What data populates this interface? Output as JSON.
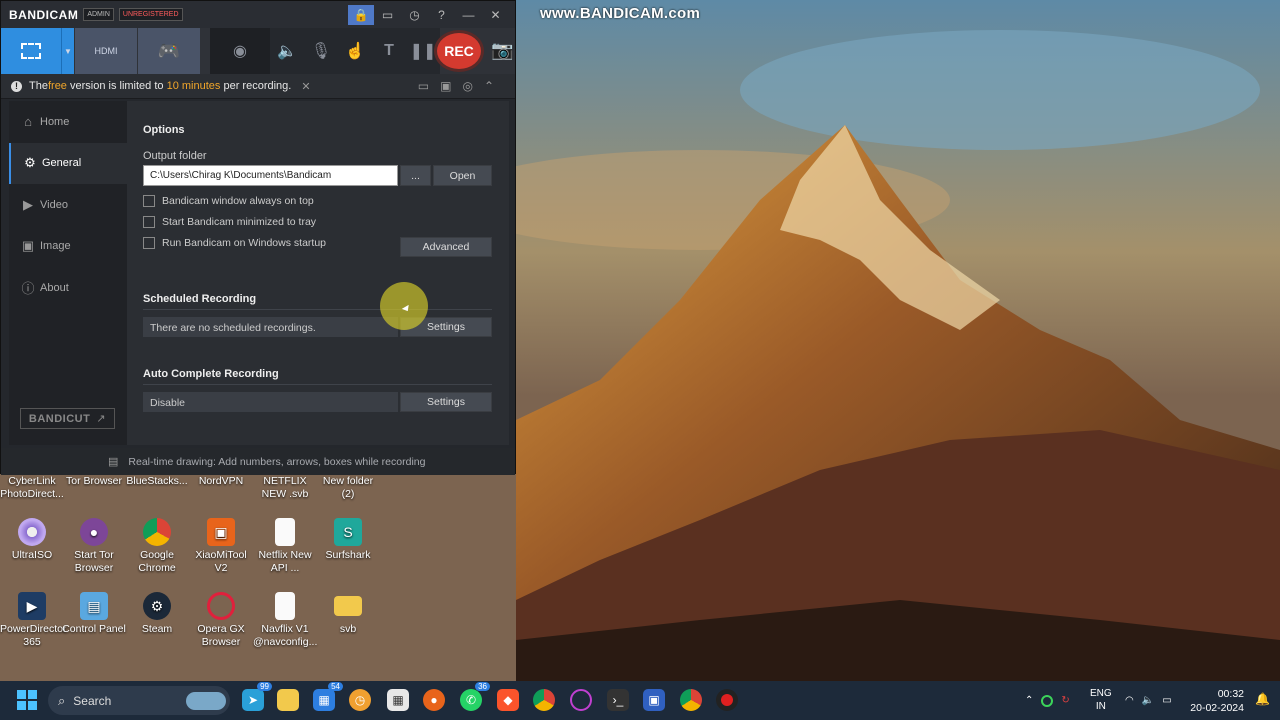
{
  "watermark": "www.BANDICAM.com",
  "window": {
    "app_name_prefix": "BANDI",
    "app_name_suffix": "CAM",
    "badge_admin": "ADMIN",
    "badge_unregistered": "UNREGISTERED",
    "rec_label": "REC",
    "notice": {
      "part1": "The ",
      "free": "free",
      "part2": " version is limited to ",
      "minutes": "10 minutes",
      "part3": " per recording."
    },
    "sidebar": {
      "items": [
        {
          "label": "Home",
          "icon": "home-icon"
        },
        {
          "label": "General",
          "icon": "gear-icon"
        },
        {
          "label": "Video",
          "icon": "video-icon"
        },
        {
          "label": "Image",
          "icon": "image-icon"
        },
        {
          "label": "About",
          "icon": "info-icon"
        }
      ],
      "bandicut": "BANDICUT"
    },
    "options": {
      "title": "Options",
      "output_folder_label": "Output folder",
      "output_folder_value": "C:\\Users\\Chirag K\\Documents\\Bandicam",
      "browse_label": "...",
      "open_label": "Open",
      "checkboxes": [
        "Bandicam window always on top",
        "Start Bandicam minimized to tray",
        "Run Bandicam on Windows startup"
      ],
      "advanced_label": "Advanced"
    },
    "scheduled": {
      "title": "Scheduled Recording",
      "value": "There are no scheduled recordings.",
      "settings_label": "Settings"
    },
    "autocomplete": {
      "title": "Auto Complete Recording",
      "value": "Disable",
      "settings_label": "Settings"
    },
    "footer": "Real-time drawing: Add numbers, arrows, boxes while recording"
  },
  "desktop": {
    "top_row": [
      "CyberLink PhotoDirect...",
      "Tor Browser",
      "BlueStacks...",
      "NordVPN",
      "NETFLIX NEW .svb",
      "New folder (2)"
    ],
    "row2": [
      "UltraISO",
      "Start Tor Browser",
      "Google Chrome",
      "XiaoMiTool V2",
      "Netflix New API ...",
      "Surfshark"
    ],
    "row3": [
      "PowerDirector 365",
      "Control Panel",
      "Steam",
      "Opera GX Browser",
      "Navflix V1 @navconfig...",
      "svb"
    ]
  },
  "taskbar": {
    "search_placeholder": "Search",
    "badge_telegram": "99",
    "badge_store": "54",
    "badge_whatsapp": "36",
    "lang_line1": "ENG",
    "lang_line2": "IN",
    "time": "00:32",
    "date": "20-02-2024"
  }
}
